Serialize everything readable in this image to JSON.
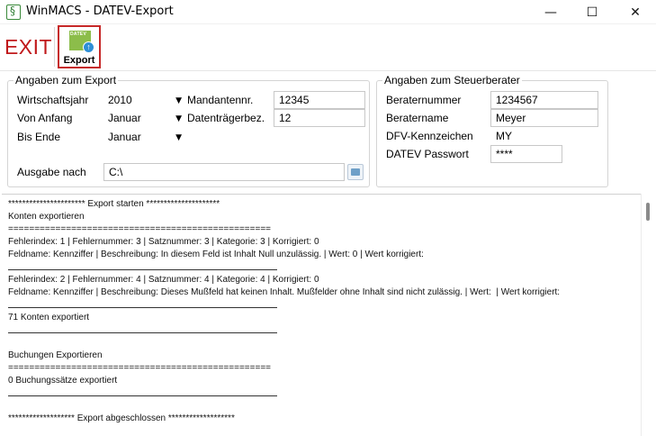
{
  "window": {
    "title": "WinMACS - DATEV-Export",
    "minimize": "—",
    "maximize": "☐",
    "close": "✕"
  },
  "toolbar": {
    "exit_label": "EXIT",
    "export_label": "Export",
    "export_icon_text": "DATEV",
    "export_icon_badge": "↑"
  },
  "export_group": {
    "legend": "Angaben zum Export",
    "wirtschaftsjahr_label": "Wirtschaftsjahr",
    "wirtschaftsjahr_value": "2010",
    "von_anfang_label": "Von Anfang",
    "von_anfang_value": "Januar",
    "bis_ende_label": "Bis Ende",
    "bis_ende_value": "Januar",
    "mandantennr_label": "Mandantennr.",
    "mandantennr_value": "12345",
    "datentraeger_label": "Datenträgerbez.",
    "datentraeger_value": "12",
    "ausgabe_label": "Ausgabe nach",
    "ausgabe_value": "C:\\"
  },
  "berater_group": {
    "legend": "Angaben zum Steuerberater",
    "nummer_label": "Beraternummer",
    "nummer_value": "1234567",
    "name_label": "Beratername",
    "name_value": "Meyer",
    "dfv_label": "DFV-Kennzeichen",
    "dfv_value": "MY",
    "passwort_label": "DATEV Passwort",
    "passwort_value": "****"
  },
  "log": [
    {
      "type": "text",
      "text": "********************** Export starten *********************"
    },
    {
      "type": "text",
      "text": "Konten exportieren"
    },
    {
      "type": "text",
      "text": "=================================================="
    },
    {
      "type": "text",
      "text": "Fehlerindex: 1 | Fehlernummer: 3 | Satznummer: 3 | Kategorie: 3 | Korrigiert: 0"
    },
    {
      "type": "text",
      "text": "Feldname: Kennziffer | Beschreibung: In diesem Feld ist Inhalt Null unzulässig. | Wert: 0 | Wert korrigiert:"
    },
    {
      "type": "sep"
    },
    {
      "type": "text",
      "text": "Fehlerindex: 2 | Fehlernummer: 4 | Satznummer: 4 | Kategorie: 4 | Korrigiert: 0"
    },
    {
      "type": "text",
      "text": "Feldname: Kennziffer | Beschreibung: Dieses Mußfeld hat keinen Inhalt. Mußfelder ohne Inhalt sind nicht zulässig. | Wert:  | Wert korrigiert:"
    },
    {
      "type": "sep"
    },
    {
      "type": "text",
      "text": "71 Konten exportiert"
    },
    {
      "type": "sep"
    },
    {
      "type": "text",
      "text": ""
    },
    {
      "type": "text",
      "text": "Buchungen Exportieren"
    },
    {
      "type": "text",
      "text": "=================================================="
    },
    {
      "type": "text",
      "text": "0 Buchungssätze exportiert"
    },
    {
      "type": "sep"
    },
    {
      "type": "text",
      "text": ""
    },
    {
      "type": "text",
      "text": "******************* Export abgeschlossen *******************"
    }
  ]
}
